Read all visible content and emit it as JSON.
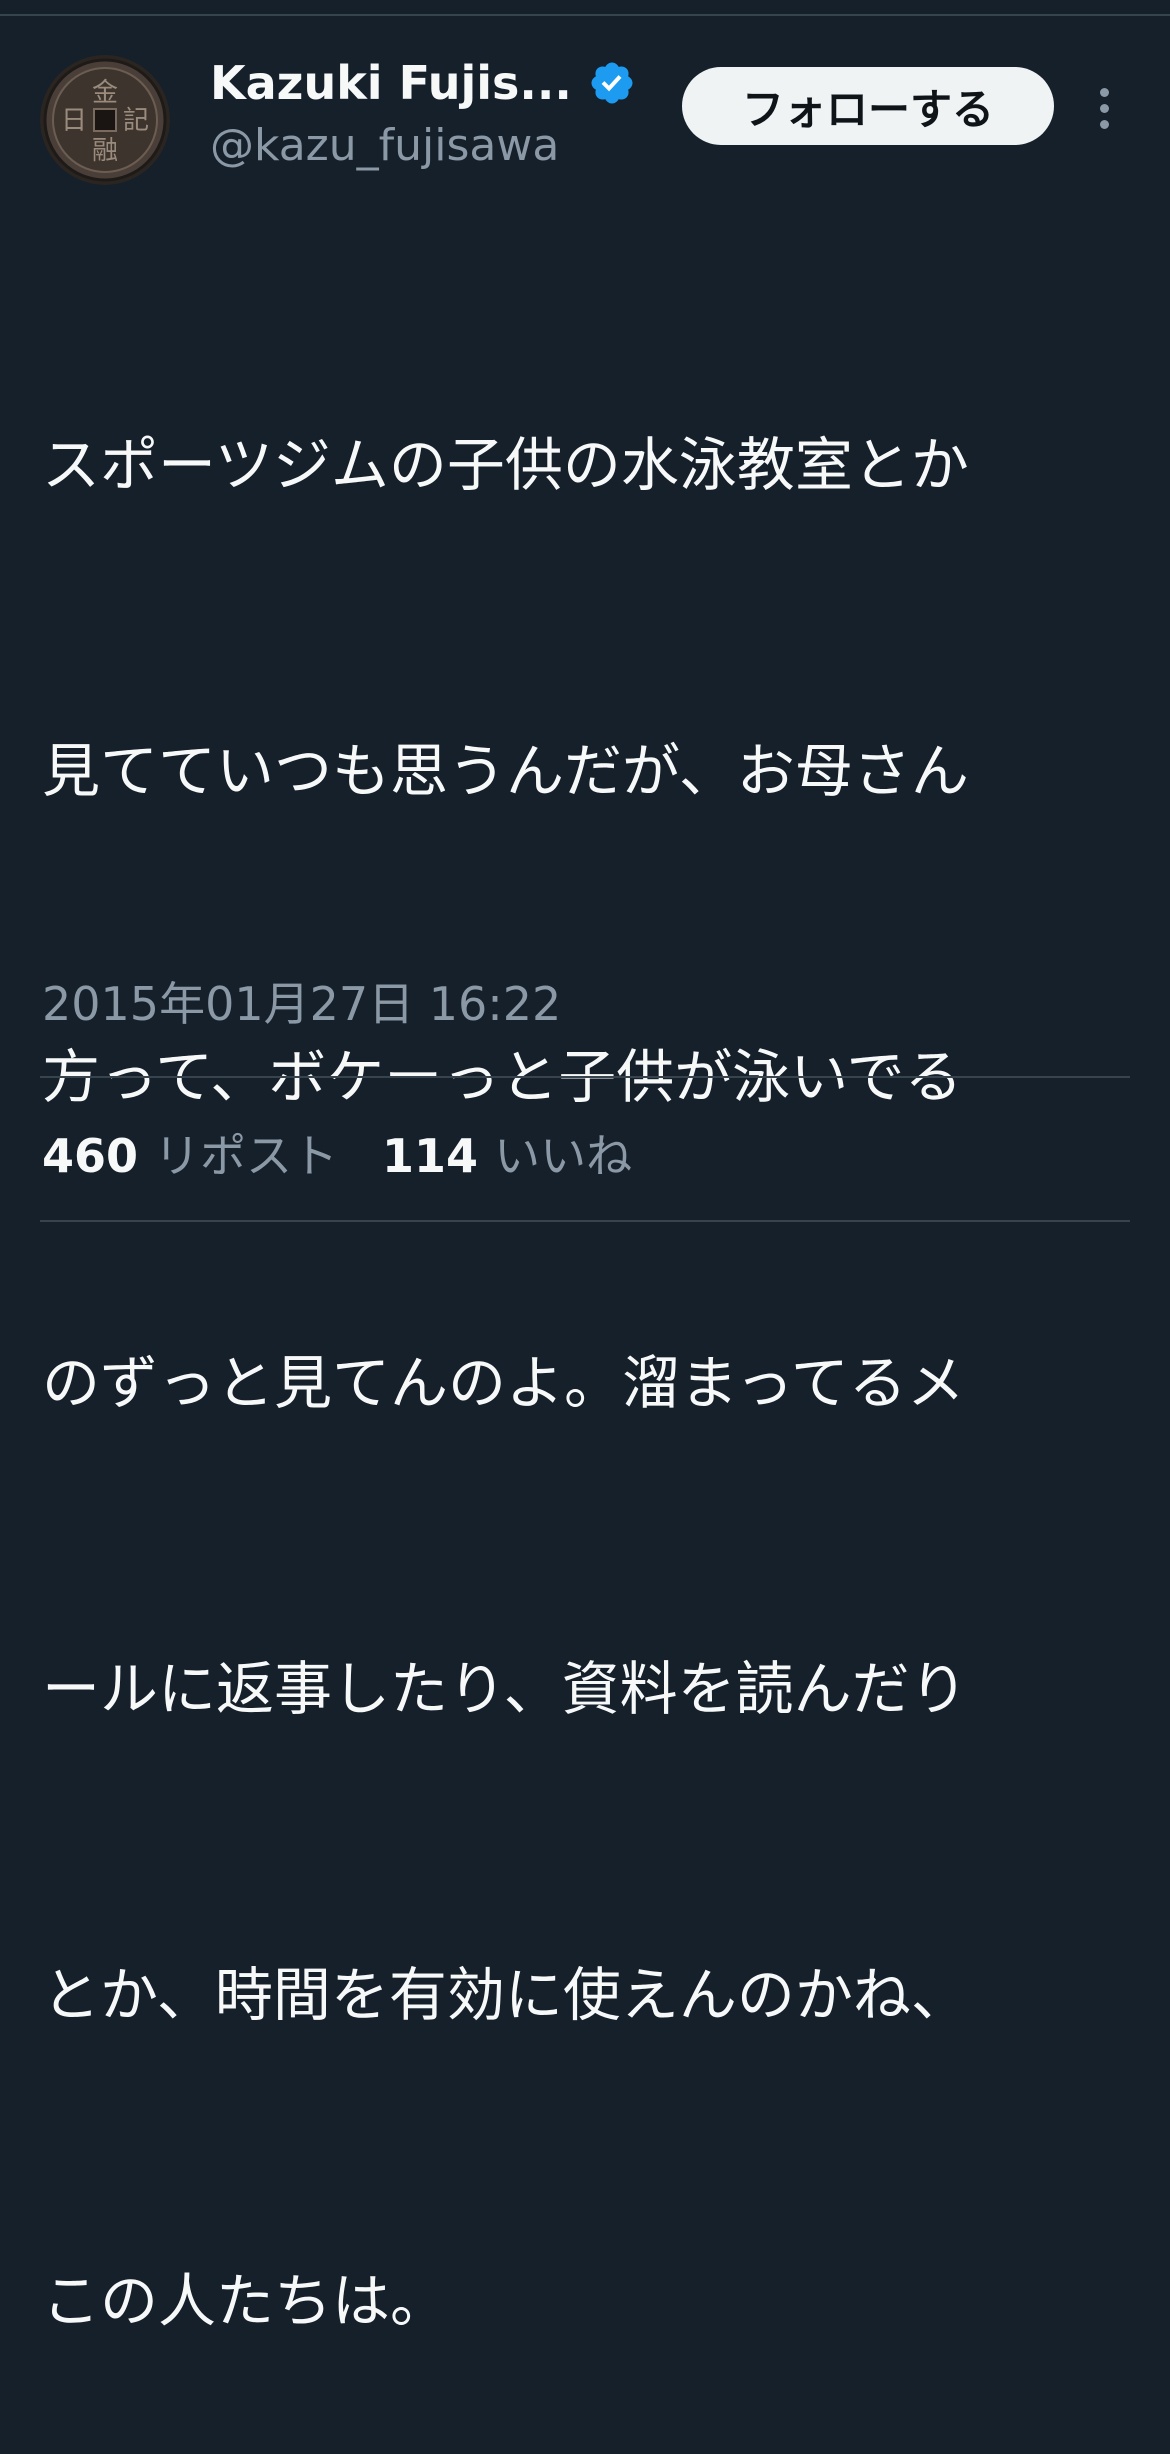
{
  "colors": {
    "background": "#15202b",
    "text_primary": "#f7f9f9",
    "text_secondary": "#8b98a5",
    "divider": "#38444d",
    "verified_badge": "#1d9bf0",
    "follow_button_bg": "#eff3f4",
    "follow_button_text": "#0f1419"
  },
  "author": {
    "display_name": "Kazuki Fujis...",
    "handle": "@kazu_fujisawa",
    "verified_icon": "verified-badge-icon",
    "avatar": {
      "icon": "old-coin-avatar",
      "chars": [
        "金",
        "記",
        "日",
        "融"
      ]
    }
  },
  "header": {
    "follow_label": "フォローする",
    "more_icon": "more-vertical-icon"
  },
  "tweet": {
    "lines": [
      "スポーツジムの子供の水泳教室とか",
      "見てていつも思うんだが、お母さん",
      "方って、ボケーっと子供が泳いでる",
      "のずっと見てんのよ。溜まってるメ",
      "ールに返事したり、資料を読んだり",
      "とか、時間を有効に使えんのかね、",
      "この人たちは。"
    ],
    "timestamp": "2015年01月27日 16:22"
  },
  "stats": {
    "reposts_count": "460",
    "reposts_label": "リポスト",
    "likes_count": "114",
    "likes_label": "いいね"
  }
}
